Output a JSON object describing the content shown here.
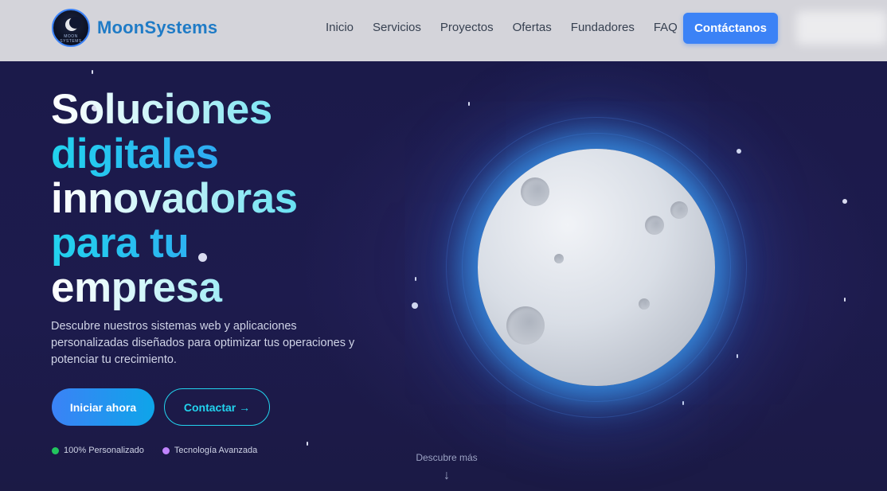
{
  "nav": {
    "brand": "MoonSystems",
    "logo_text": "MOON SYSTEMS",
    "links": [
      "Inicio",
      "Servicios",
      "Proyectos",
      "Ofertas",
      "Fundadores",
      "FAQ"
    ],
    "cta": "Contáctanos"
  },
  "hero": {
    "headline": [
      "Soluciones",
      "digitales",
      "innovadoras",
      "para tu",
      "empresa"
    ],
    "subtitle": "Descubre nuestros sistemas web y aplicaciones personalizadas diseñados para optimizar tus operaciones y potenciar tu crecimiento.",
    "primary_button": "Iniciar ahora",
    "secondary_button": "Contactar →",
    "features": [
      {
        "label": "100% Personalizado",
        "color": "#22c55e"
      },
      {
        "label": "Tecnología Avanzada",
        "color": "#c084fc"
      }
    ],
    "scroll_hint": "Descubre más",
    "scroll_arrow": "↓"
  },
  "colors": {
    "accent": "#3b82f6",
    "cyan": "#22d3ee",
    "brand": "#1f7bc6",
    "hero_bg": "#1b1a4a"
  }
}
